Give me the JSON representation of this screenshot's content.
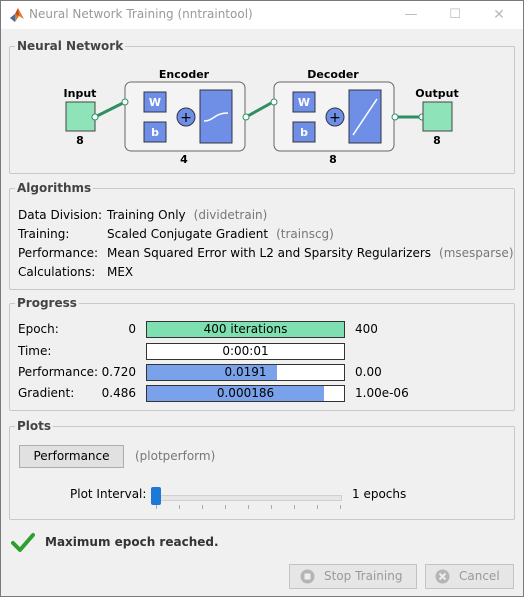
{
  "window": {
    "title": "Neural Network Training (nntraintool)",
    "minimize": "—",
    "maximize": "☐",
    "close": "✕"
  },
  "network": {
    "section_title": "Neural Network",
    "input_label": "Input",
    "input_size": "8",
    "encoder_label": "Encoder",
    "encoder_size": "4",
    "decoder_label": "Decoder",
    "decoder_size": "8",
    "output_label": "Output",
    "output_size": "8",
    "weight_label": "W",
    "bias_label": "b",
    "colors": {
      "block": "#8fe3b8",
      "weight": "#6f8fe6",
      "transfer": "#6f8fe6",
      "line": "#2f8f63"
    }
  },
  "algorithms": {
    "section_title": "Algorithms",
    "rows": [
      {
        "label": "Data Division:",
        "value": "Training Only",
        "fn": "(dividetrain)"
      },
      {
        "label": "Training:",
        "value": "Scaled Conjugate Gradient",
        "fn": "(trainscg)"
      },
      {
        "label": "Performance:",
        "value": "Mean Squared Error with L2 and Sparsity Regularizers",
        "fn": "(msesparse)"
      },
      {
        "label": "Calculations:",
        "value": "MEX",
        "fn": ""
      }
    ]
  },
  "progress": {
    "section_title": "Progress",
    "rows": [
      {
        "label": "Epoch:",
        "min": "0",
        "text": "400 iterations",
        "max": "400",
        "fill": 1.0,
        "color": "#7ee0b0"
      },
      {
        "label": "Time:",
        "min": "",
        "text": "0:00:01",
        "max": "",
        "fill": 0.0,
        "color": "#7aa2ea"
      },
      {
        "label": "Performance:",
        "min": "0.720",
        "text": "0.0191",
        "max": "0.00",
        "fill": 0.66,
        "color": "#7aa2ea"
      },
      {
        "label": "Gradient:",
        "min": "0.486",
        "text": "0.000186",
        "max": "1.00e-06",
        "fill": 0.9,
        "color": "#7aa2ea"
      }
    ]
  },
  "plots": {
    "section_title": "Plots",
    "performance_button": "Performance",
    "performance_fn": "(plotperform)",
    "interval_label": "Plot Interval:",
    "interval_value": "1 epochs",
    "slider_fraction": 0.0
  },
  "status": {
    "message": "Maximum epoch reached.",
    "icon": "checkmark-icon",
    "color": "#2e9e2e"
  },
  "buttons": {
    "stop": "Stop Training",
    "cancel": "Cancel"
  }
}
